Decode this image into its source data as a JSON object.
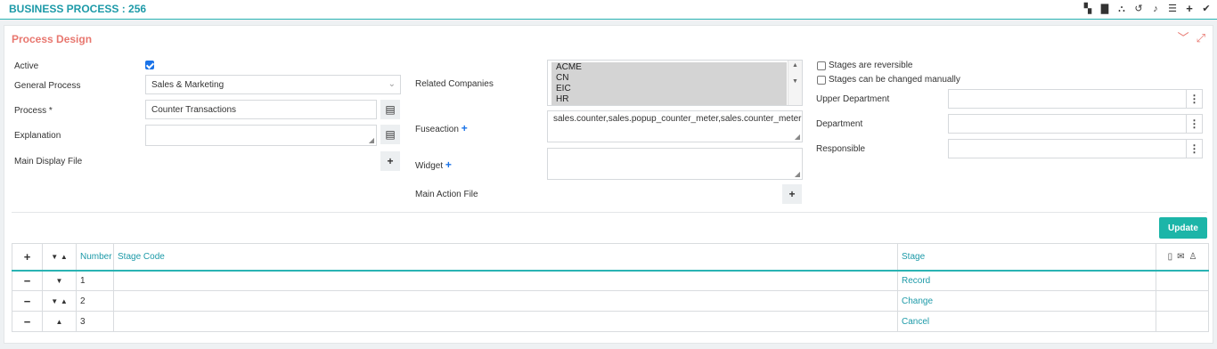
{
  "header": {
    "title": "BUSINESS PROCESS : 256",
    "icons": [
      "qr-icon",
      "folder-icon",
      "sitemap-icon",
      "history-icon",
      "bell-icon",
      "list-icon",
      "plus-icon",
      "check-icon"
    ]
  },
  "panel": {
    "title": "Process Design",
    "tools": [
      "collapse-icon",
      "expand-icon"
    ]
  },
  "form": {
    "active_label": "Active",
    "active_checked": true,
    "general_process_label": "General Process",
    "general_process_value": "Sales & Marketing",
    "process_label": "Process *",
    "process_value": "Counter Transactions",
    "explanation_label": "Explanation",
    "explanation_value": "",
    "main_display_file_label": "Main Display File",
    "related_companies_label": "Related Companies",
    "related_companies": [
      "ACME",
      "CN",
      "EIC",
      "HR"
    ],
    "fuseaction_label": "Fuseaction",
    "fuseaction_value": "sales.counter,sales.popup_counter_meter,sales.counter_meter",
    "widget_label": "Widget",
    "widget_value": "",
    "main_action_file_label": "Main Action File",
    "stages_reversible_label": "Stages are reversible",
    "stages_manual_label": "Stages can be changed manually",
    "upper_department_label": "Upper Department",
    "department_label": "Department",
    "responsible_label": "Responsible",
    "update_label": "Update"
  },
  "table": {
    "headers": {
      "number": "Number",
      "stage_code": "Stage Code",
      "stage": "Stage"
    },
    "rows": [
      {
        "number": "1",
        "stage_code": "",
        "stage": "Record",
        "arrows": "down"
      },
      {
        "number": "2",
        "stage_code": "",
        "stage": "Change",
        "arrows": "both"
      },
      {
        "number": "3",
        "stage_code": "",
        "stage": "Cancel",
        "arrows": "up"
      }
    ]
  },
  "colors": {
    "accent_teal": "#1d9aa8",
    "panel_title": "#e8776f",
    "update_button": "#1cb5a8"
  }
}
